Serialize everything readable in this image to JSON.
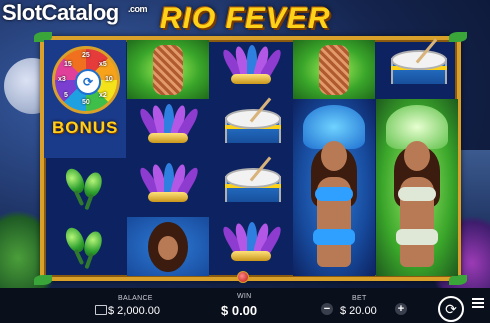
{
  "watermark": {
    "brand": "SlotCatalog",
    "domain": ".com"
  },
  "game": {
    "title": "RIO FEVER"
  },
  "reels": {
    "bonus_label": "BONUS",
    "wheel_numbers": [
      "25",
      "x5",
      "10",
      "x2",
      "50",
      "5",
      "x3",
      "15"
    ]
  },
  "icons": [
    "maracas-icon",
    "headdress-icon",
    "drum-icon",
    "dancer-icon",
    "wheel-icon",
    "wallet-icon",
    "minus-icon",
    "plus-icon",
    "spin-icon",
    "menu-icon"
  ],
  "colors": {
    "frame_gold": "#d9a12a",
    "title_yellow": "#ffd21a",
    "bar_bg": "#0a0f1c"
  },
  "bottom_bar": {
    "balance_label": "BALANCE",
    "balance_value": "$ 2,000.00",
    "win_label": "WIN",
    "win_value": "$ 0.00",
    "bet_label": "BET",
    "bet_value": "$ 20.00",
    "bet_minus": "−",
    "bet_plus": "+",
    "spin_glyph": "⟳"
  }
}
